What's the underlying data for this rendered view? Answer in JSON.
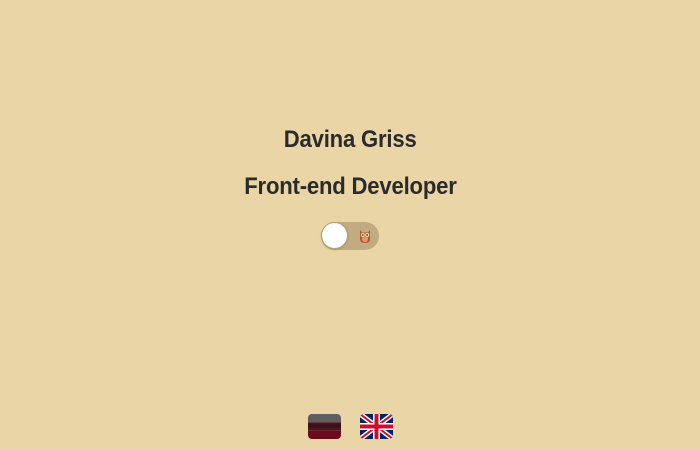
{
  "profile": {
    "name": "Davina Griss",
    "role": "Front-end Developer"
  },
  "theme_toggle": {
    "state": "off",
    "icon": "owl-icon"
  },
  "languages": [
    {
      "icon": "german-flag-icon"
    },
    {
      "icon": "uk-flag-icon"
    }
  ],
  "colors": {
    "background": "#e9d5a5",
    "text": "#2b2b2b",
    "toggle_track": "#c1ab81",
    "toggle_knob": "#ffffff"
  }
}
